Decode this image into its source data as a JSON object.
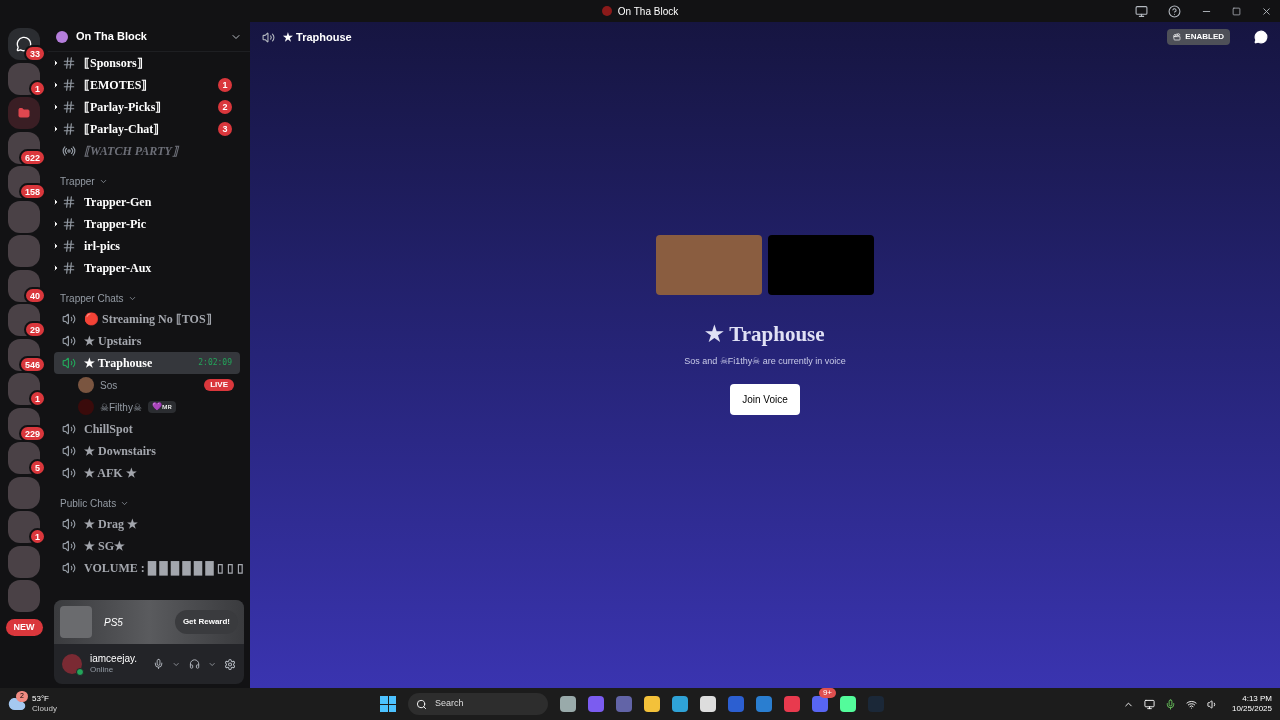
{
  "window": {
    "title": "On Tha Block"
  },
  "servers": [
    {
      "kind": "home",
      "badge": "33"
    },
    {
      "kind": "server",
      "badge": "1"
    },
    {
      "kind": "folder"
    },
    {
      "kind": "server",
      "badge": "622"
    },
    {
      "kind": "server",
      "badge": "158"
    },
    {
      "kind": "server"
    },
    {
      "kind": "server"
    },
    {
      "kind": "server",
      "badge": "40"
    },
    {
      "kind": "server",
      "badge": "29"
    },
    {
      "kind": "server",
      "badge": "546"
    },
    {
      "kind": "server",
      "badge": "1"
    },
    {
      "kind": "server",
      "badge": "229"
    },
    {
      "kind": "server",
      "badge": "5"
    },
    {
      "kind": "server"
    },
    {
      "kind": "server",
      "badge": "1"
    },
    {
      "kind": "server"
    },
    {
      "kind": "server"
    },
    {
      "kind": "new",
      "label": "NEW"
    }
  ],
  "guild": {
    "name": "On Tha Block"
  },
  "channels": [
    {
      "kind": "text",
      "label": "⟦Sponsors⟧"
    },
    {
      "kind": "text",
      "label": "⟦EMOTES⟧",
      "badge": "1"
    },
    {
      "kind": "text",
      "label": "⟦Parlay-Picks⟧",
      "badge": "2"
    },
    {
      "kind": "text",
      "label": "⟦Parlay-Chat⟧",
      "badge": "3"
    },
    {
      "kind": "stage",
      "label": "⟦WATCH PARTY⟧"
    },
    {
      "kind": "category",
      "label": "Trapper"
    },
    {
      "kind": "text",
      "label": "Trapper-Gen"
    },
    {
      "kind": "text",
      "label": "Trapper-Pic"
    },
    {
      "kind": "text",
      "label": "irl-pics"
    },
    {
      "kind": "text",
      "label": "Trapper-Aux"
    },
    {
      "kind": "category",
      "label": "Trapper Chats"
    },
    {
      "kind": "voice",
      "label": "🔴 Streaming No ⟦TOS⟧",
      "selected": false
    },
    {
      "kind": "voice",
      "label": "★ Upstairs",
      "selected": false
    },
    {
      "kind": "voice",
      "label": "★ Traphouse",
      "selected": true,
      "timer": "2:02:09",
      "users": [
        {
          "name": "Sos",
          "live": "LIVE"
        },
        {
          "name": "☠Filthy☠",
          "tag": "💜ᴍʀ"
        }
      ]
    },
    {
      "kind": "voice",
      "label": "ChillSpot",
      "selected": false
    },
    {
      "kind": "voice",
      "label": "★ Downstairs",
      "selected": false
    },
    {
      "kind": "voice",
      "label": "★ AFK ★",
      "selected": false
    },
    {
      "kind": "category",
      "label": "Public Chats"
    },
    {
      "kind": "voice",
      "label": "★ Drag ★",
      "selected": false
    },
    {
      "kind": "voice",
      "label": "★ SG★",
      "selected": false
    },
    {
      "kind": "voice",
      "label": "VOLUME : █ █ █ █ █ █ ▯ ▯ ▯",
      "selected": false
    }
  ],
  "promo": {
    "brand": "PS5",
    "button": "Get Reward!"
  },
  "user": {
    "name": "iamceejay.",
    "status": "Online"
  },
  "header": {
    "title": "★ Traphouse",
    "badge": "ENABLED"
  },
  "stage": {
    "title": "★ Traphouse",
    "subtitle": "Sos and ☠Fi1thy☠ are currently in voice",
    "button": "Join Voice"
  },
  "taskbar": {
    "weather": {
      "temp": "53°F",
      "condition": "Cloudy",
      "badge": "2"
    },
    "search": {
      "placeholder": "Search"
    },
    "discord_badge": "9+",
    "time": "4:13 PM",
    "date": "10/25/2025"
  }
}
